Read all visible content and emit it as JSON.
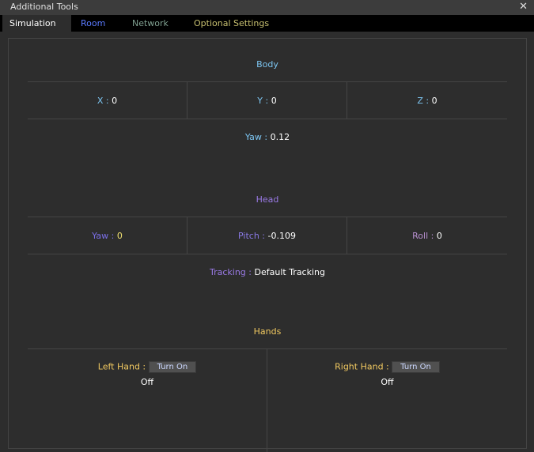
{
  "window": {
    "title": "Additional Tools"
  },
  "tabs": [
    {
      "label": "Simulation",
      "color": "#ffffff"
    },
    {
      "label": "Room",
      "color": "#5a7aff"
    },
    {
      "label": "Network",
      "color": "#7fa090"
    },
    {
      "label": "Optional Settings",
      "color": "#c8c070"
    }
  ],
  "body": {
    "heading": "Body",
    "x_label": "X : ",
    "x": "0",
    "y_label": "Y : ",
    "y": "0",
    "z_label": "Z : ",
    "z": "0",
    "yaw_label": "Yaw : ",
    "yaw": "0.12"
  },
  "head": {
    "heading": "Head",
    "yaw_label": "Yaw : ",
    "yaw": "0",
    "pitch_label": "Pitch : ",
    "pitch": "-0.109",
    "roll_label": "Roll : ",
    "roll": "0",
    "tracking_label": "Tracking : ",
    "tracking": "Default Tracking"
  },
  "hands": {
    "heading": "Hands",
    "left_label": "Left Hand : ",
    "left_button": "Turn On",
    "left_status": "Off",
    "right_label": "Right Hand : ",
    "right_button": "Turn On",
    "right_status": "Off"
  }
}
